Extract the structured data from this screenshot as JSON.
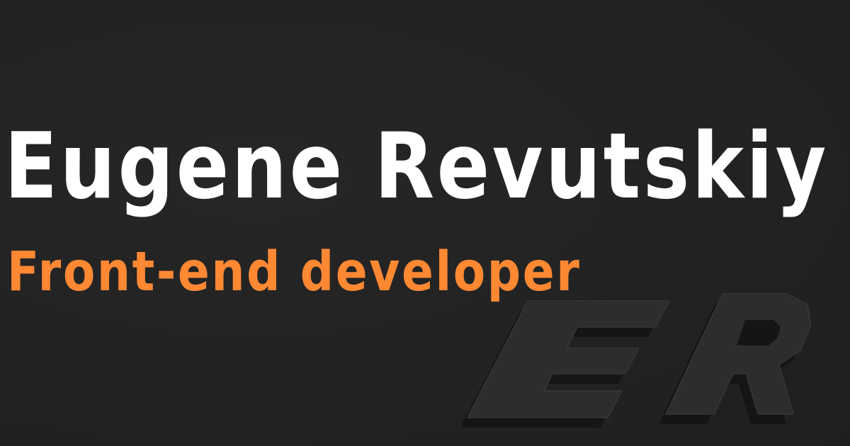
{
  "card": {
    "name": "Eugene Revutskiy",
    "role": "Front-end developer",
    "logo_text": "ER",
    "logo_icon": "er-monogram-3d-icon"
  },
  "colors": {
    "background": "#232323",
    "name": "#ffffff",
    "role": "#ff8833",
    "logo_face": "#2e2e2e",
    "logo_side": "#141414"
  }
}
